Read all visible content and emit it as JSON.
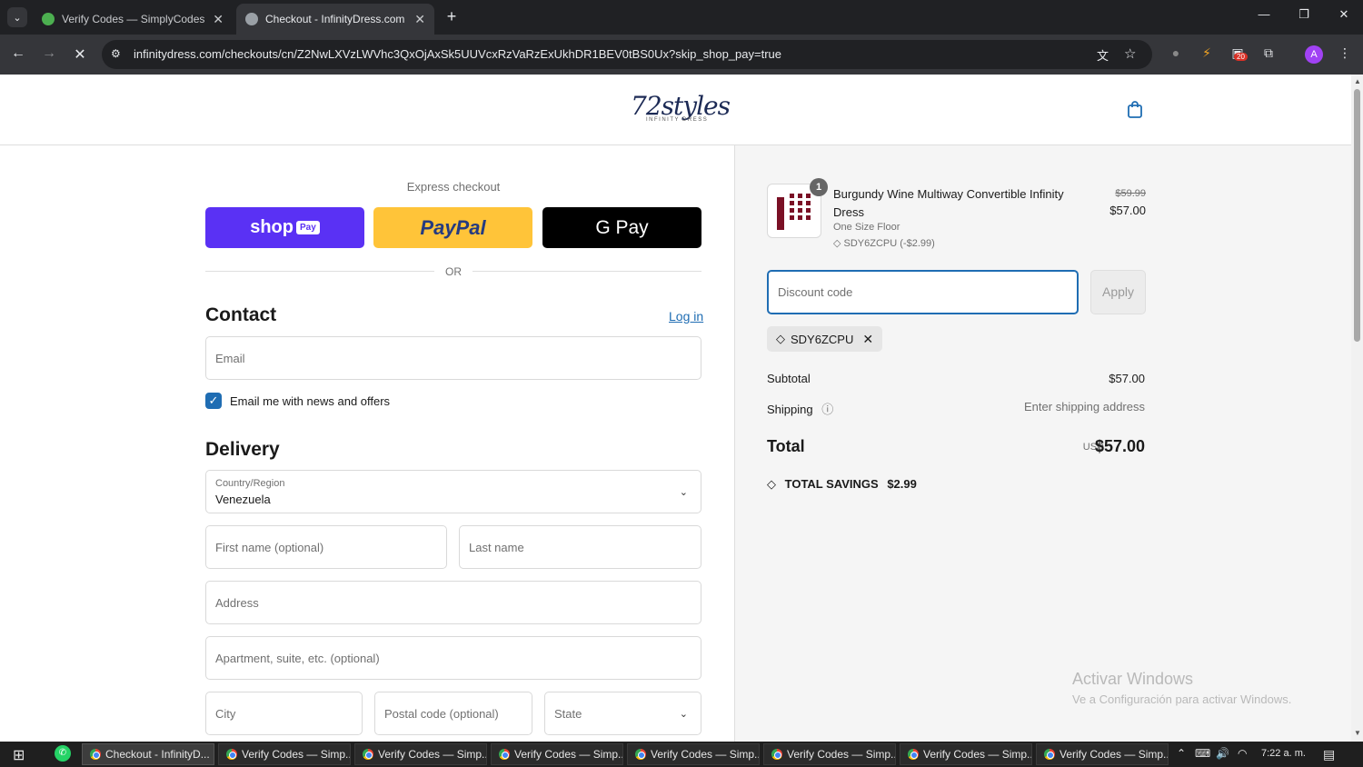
{
  "browser": {
    "tabs": [
      {
        "title": "Verify Codes — SimplyCodes",
        "active": false
      },
      {
        "title": "Checkout - InfinityDress.com",
        "active": true
      }
    ],
    "url": "infinitydress.com/checkouts/cn/Z2NwLXVzLWVhc3QxOjAxSk5UUVcxRzVaRzExUkhDR1BEV0tBS0Ux?skip_shop_pay=true",
    "extension_badge": "20",
    "profile_initial": "A"
  },
  "store": {
    "logo_text": "72styles",
    "logo_sub": "INFINITY DRESS"
  },
  "checkout": {
    "express_label": "Express checkout",
    "shop_pay": {
      "word": "shop",
      "pill": "Pay"
    },
    "paypal_label": "PayPal",
    "gpay_label": "G Pay",
    "or_label": "OR",
    "contact_heading": "Contact",
    "login_label": "Log in",
    "email_placeholder": "Email",
    "newsletter_label": "Email me with news and offers",
    "newsletter_checked": true,
    "delivery_heading": "Delivery",
    "country_label": "Country/Region",
    "country_value": "Venezuela",
    "first_name_placeholder": "First name (optional)",
    "last_name_placeholder": "Last name",
    "address_placeholder": "Address",
    "apartment_placeholder": "Apartment, suite, etc. (optional)",
    "city_placeholder": "City",
    "postal_placeholder": "Postal code (optional)",
    "state_placeholder": "State"
  },
  "summary": {
    "product": {
      "quantity": "1",
      "name": "Burgundy Wine Multiway Convertible Infinity Dress",
      "variant": "One Size Floor",
      "discount": "SDY6ZCPU (-$2.99)",
      "price_original": "$59.99",
      "price": "$57.00"
    },
    "discount_placeholder": "Discount code",
    "apply_label": "Apply",
    "applied_code": "SDY6ZCPU",
    "subtotal_label": "Subtotal",
    "subtotal_value": "$57.00",
    "shipping_label": "Shipping",
    "shipping_value": "Enter shipping address",
    "total_label": "Total",
    "total_currency": "USD",
    "total_value": "$57.00",
    "savings_label": "TOTAL SAVINGS",
    "savings_value": "$2.99"
  },
  "watermark": {
    "line1": "Activar Windows",
    "line2": "Ve a Configuración para activar Windows."
  },
  "taskbar": {
    "items": [
      "Checkout - InfinityD...",
      "Verify Codes — Simp...",
      "Verify Codes — Simp...",
      "Verify Codes — Simp...",
      "Verify Codes — Simp...",
      "Verify Codes — Simp...",
      "Verify Codes — Simp...",
      "Verify Codes — Simp..."
    ],
    "clock": "7:22 a. m."
  },
  "colors": {
    "accent": "#1f6db3",
    "shop_pay": "#5a31f4",
    "paypal": "#ffc439",
    "product": "#7a1025"
  }
}
